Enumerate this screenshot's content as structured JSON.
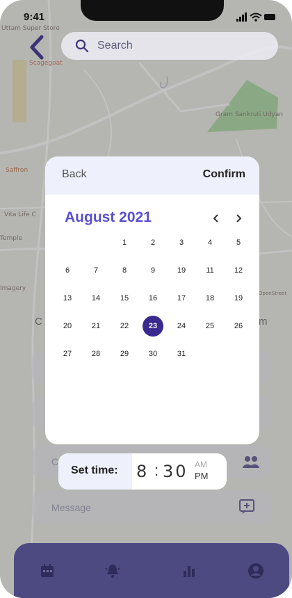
{
  "status_bar": {
    "time": "9:41"
  },
  "map_labels": {
    "uttam_super_store": "Uttam Super Store",
    "scagegoat": "Scagegoat",
    "gram_sankruti_udyan": "Gram Sankruti Udyan",
    "saffron": "Saffron",
    "vita_life": "Vita Life C",
    "temple": "Temple",
    "imagery": "Imagery",
    "open_street": "OpenStreet"
  },
  "search": {
    "placeholder": "Search"
  },
  "form": {
    "label_c": "C",
    "label_m": "m",
    "label_c2": "C",
    "message_placeholder": "Message"
  },
  "modal": {
    "back_label": "Back",
    "confirm_label": "Confirm",
    "month_label": "August 2021",
    "prev_glyph": "<",
    "next_glyph": ">",
    "days": [
      "1",
      "2",
      "3",
      "4",
      "5",
      "6",
      "7",
      "8",
      "9",
      "19",
      "11",
      "12",
      "13",
      "14",
      "15",
      "16",
      "17",
      "18",
      "19",
      "20",
      "21",
      "22",
      "23",
      "24",
      "25",
      "26",
      "27",
      "28",
      "29",
      "30",
      "31"
    ],
    "selected_day": "23"
  },
  "time_picker": {
    "label": "Set time:",
    "hour": "8",
    "separator": ":",
    "minute": "30",
    "am": "AM",
    "pm": "PM"
  },
  "colors": {
    "accent": "#5a4fcf",
    "selected_day": "#3a2a8f",
    "nav_bar": "#4d4a82"
  }
}
